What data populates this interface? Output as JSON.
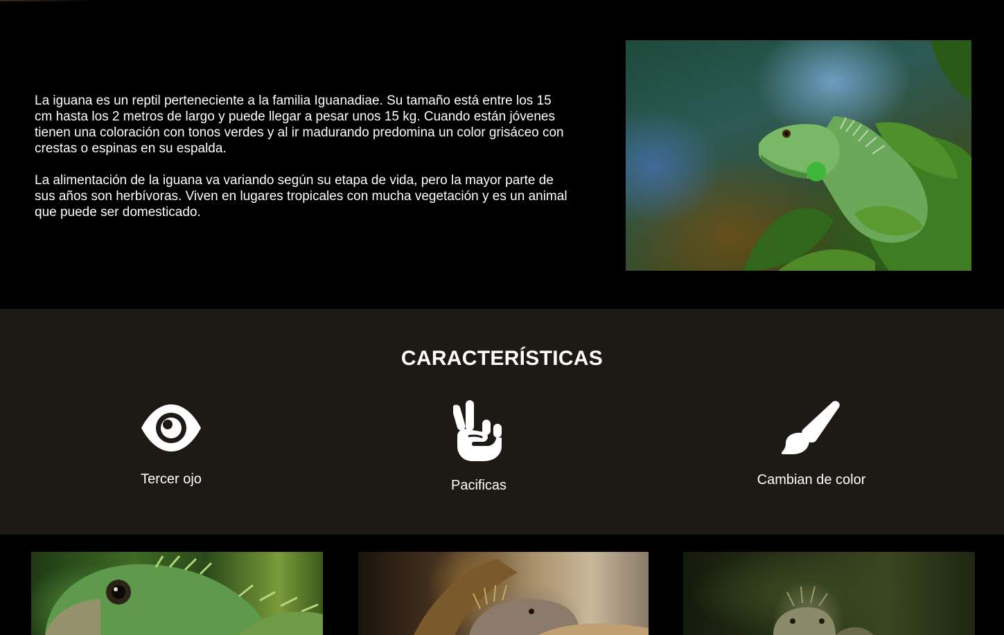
{
  "intro": {
    "paragraph_1": "La iguana es un reptil perteneciente a la familia Iguanadiae. Su tamaño está entre los 15 cm hasta los 2 metros de largo y puede llegar a pesar unos 15 kg. Cuando están jóvenes tienen una coloración con tonos verdes y al ir madurando predomina un color grisáceo con crestas o espinas en su espalda.",
    "paragraph_2": "La alimentación de la iguana va variando según su etapa de vida, pero la mayor parte de sus años son herbívoras. Viven en lugares tropicales con mucha vegetación y es un animal que puede ser domesticado."
  },
  "features": {
    "title": "CARACTERÍSTICAS",
    "items": [
      {
        "icon": "eye-icon",
        "label": "Tercer ojo"
      },
      {
        "icon": "peace-hand-icon",
        "label": "Pacificas"
      },
      {
        "icon": "paint-brush-icon",
        "label": "Cambian de color"
      }
    ]
  },
  "colors": {
    "page_background": "#000000",
    "features_background": "#1d1914",
    "text": "#ffffff"
  }
}
